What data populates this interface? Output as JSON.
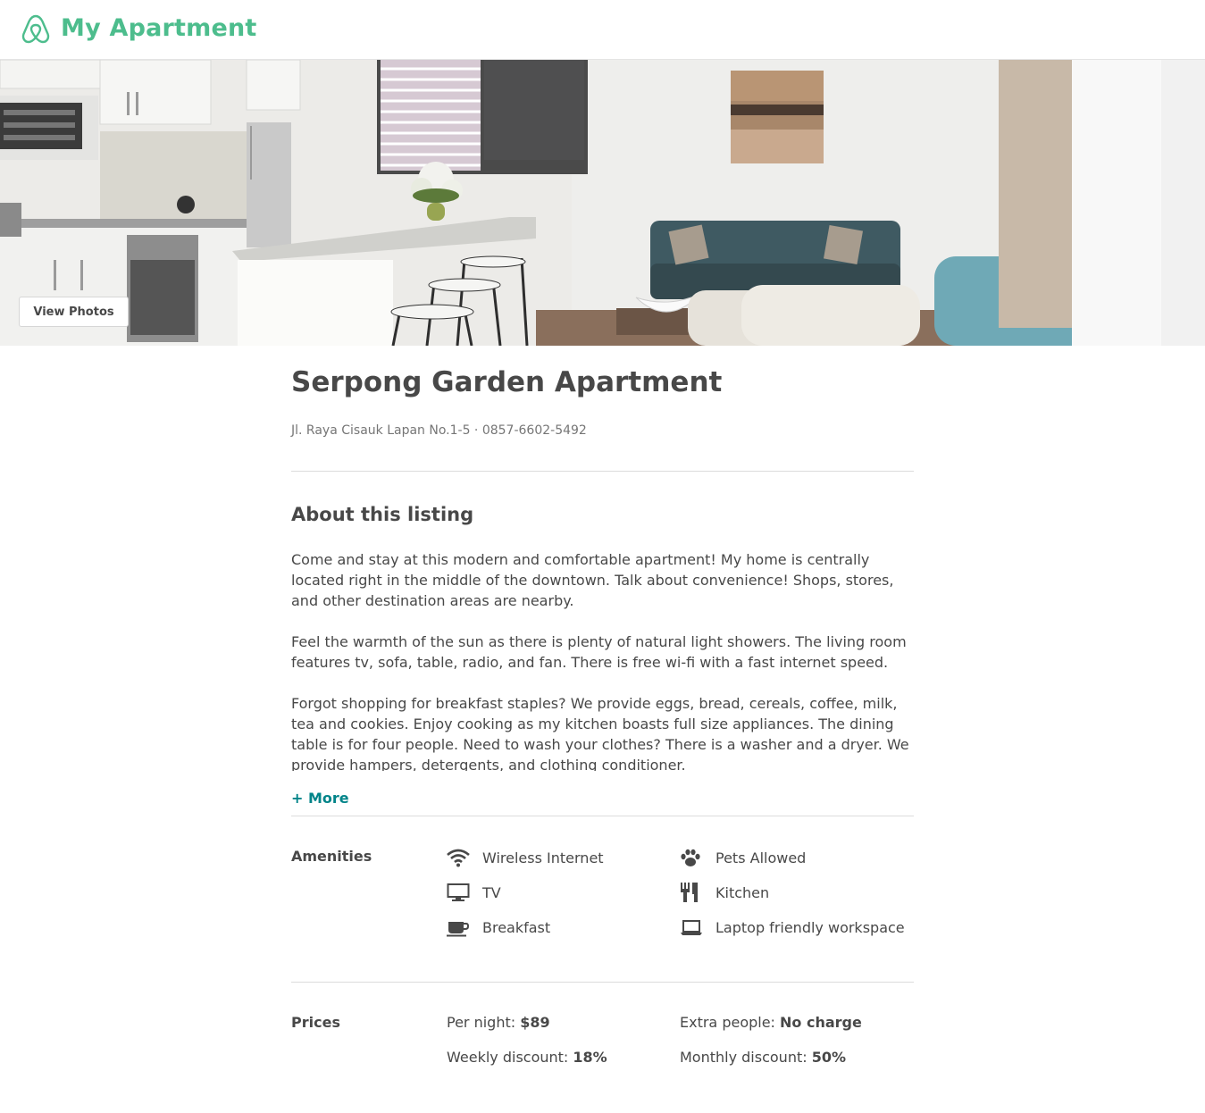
{
  "header": {
    "brand": "My Apartment",
    "brand_color": "#4dbd8d",
    "logo_icon": "airbnb-belo-icon"
  },
  "hero": {
    "view_photos_label": "View Photos"
  },
  "listing": {
    "title": "Serpong Garden Apartment",
    "address": "Jl. Raya Cisauk Lapan No.1-5 · 0857-6602-5492"
  },
  "about": {
    "heading": "About this listing",
    "paragraphs": [
      "Come and stay at this modern and comfortable apartment! My home is centrally located right in the middle  of the downtown. Talk about convenience! Shops, stores, and other destination areas are nearby.",
      "Feel the warmth of the sun as there is plenty of natural light showers. The living room features tv, sofa, table, radio, and fan. There is free wi-fi with a fast internet speed.",
      "Forgot shopping for breakfast staples? We provide eggs, bread, cereals, coffee, milk, tea and cookies. Enjoy cooking as my kitchen boasts full size appliances. The dining table is for four people. Need to wash your clothes? There is a washer and a dryer. We provide hampers, detergents, and clothing conditioner."
    ],
    "more_label": "+ More",
    "more_color": "#008489"
  },
  "amenities": {
    "label": "Amenities",
    "items": [
      {
        "icon": "wifi-icon",
        "text": "Wireless Internet"
      },
      {
        "icon": "paw-icon",
        "text": "Pets Allowed"
      },
      {
        "icon": "tv-icon",
        "text": "TV"
      },
      {
        "icon": "cutlery-icon",
        "text": "Kitchen"
      },
      {
        "icon": "coffee-cup-icon",
        "text": "Breakfast"
      },
      {
        "icon": "laptop-icon",
        "text": "Laptop friendly workspace"
      }
    ]
  },
  "prices": {
    "label": "Prices",
    "per_night_label": "Per night: ",
    "per_night_value": "$89",
    "extra_people_label": "Extra people: ",
    "extra_people_value": "No charge",
    "weekly_label": "Weekly discount: ",
    "weekly_value": "18%",
    "monthly_label": "Monthly discount: ",
    "monthly_value": "50%"
  }
}
